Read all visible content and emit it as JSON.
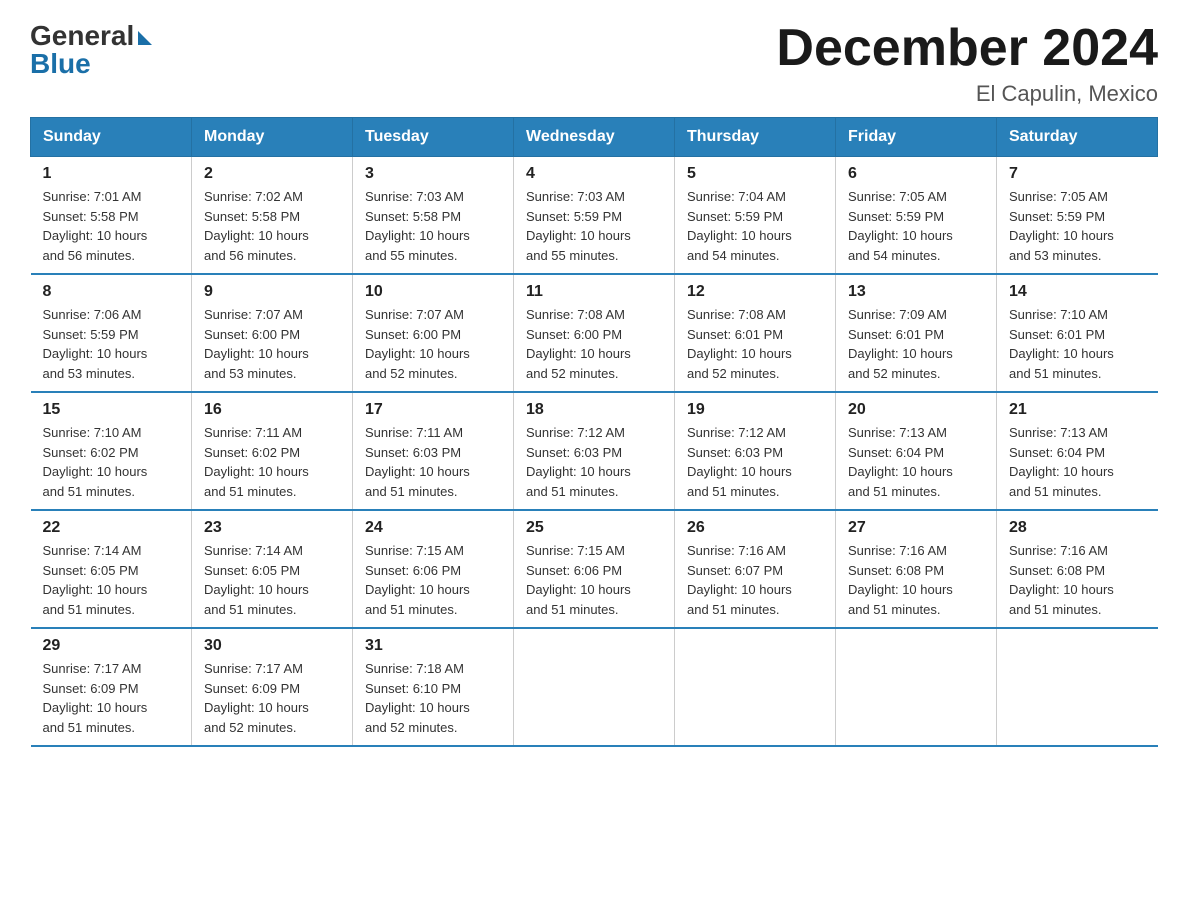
{
  "logo": {
    "general": "General",
    "blue": "Blue"
  },
  "title": {
    "month_year": "December 2024",
    "location": "El Capulin, Mexico"
  },
  "days_of_week": [
    "Sunday",
    "Monday",
    "Tuesday",
    "Wednesday",
    "Thursday",
    "Friday",
    "Saturday"
  ],
  "weeks": [
    [
      {
        "day": "1",
        "sunrise": "7:01 AM",
        "sunset": "5:58 PM",
        "daylight": "10 hours and 56 minutes."
      },
      {
        "day": "2",
        "sunrise": "7:02 AM",
        "sunset": "5:58 PM",
        "daylight": "10 hours and 56 minutes."
      },
      {
        "day": "3",
        "sunrise": "7:03 AM",
        "sunset": "5:58 PM",
        "daylight": "10 hours and 55 minutes."
      },
      {
        "day": "4",
        "sunrise": "7:03 AM",
        "sunset": "5:59 PM",
        "daylight": "10 hours and 55 minutes."
      },
      {
        "day": "5",
        "sunrise": "7:04 AM",
        "sunset": "5:59 PM",
        "daylight": "10 hours and 54 minutes."
      },
      {
        "day": "6",
        "sunrise": "7:05 AM",
        "sunset": "5:59 PM",
        "daylight": "10 hours and 54 minutes."
      },
      {
        "day": "7",
        "sunrise": "7:05 AM",
        "sunset": "5:59 PM",
        "daylight": "10 hours and 53 minutes."
      }
    ],
    [
      {
        "day": "8",
        "sunrise": "7:06 AM",
        "sunset": "5:59 PM",
        "daylight": "10 hours and 53 minutes."
      },
      {
        "day": "9",
        "sunrise": "7:07 AM",
        "sunset": "6:00 PM",
        "daylight": "10 hours and 53 minutes."
      },
      {
        "day": "10",
        "sunrise": "7:07 AM",
        "sunset": "6:00 PM",
        "daylight": "10 hours and 52 minutes."
      },
      {
        "day": "11",
        "sunrise": "7:08 AM",
        "sunset": "6:00 PM",
        "daylight": "10 hours and 52 minutes."
      },
      {
        "day": "12",
        "sunrise": "7:08 AM",
        "sunset": "6:01 PM",
        "daylight": "10 hours and 52 minutes."
      },
      {
        "day": "13",
        "sunrise": "7:09 AM",
        "sunset": "6:01 PM",
        "daylight": "10 hours and 52 minutes."
      },
      {
        "day": "14",
        "sunrise": "7:10 AM",
        "sunset": "6:01 PM",
        "daylight": "10 hours and 51 minutes."
      }
    ],
    [
      {
        "day": "15",
        "sunrise": "7:10 AM",
        "sunset": "6:02 PM",
        "daylight": "10 hours and 51 minutes."
      },
      {
        "day": "16",
        "sunrise": "7:11 AM",
        "sunset": "6:02 PM",
        "daylight": "10 hours and 51 minutes."
      },
      {
        "day": "17",
        "sunrise": "7:11 AM",
        "sunset": "6:03 PM",
        "daylight": "10 hours and 51 minutes."
      },
      {
        "day": "18",
        "sunrise": "7:12 AM",
        "sunset": "6:03 PM",
        "daylight": "10 hours and 51 minutes."
      },
      {
        "day": "19",
        "sunrise": "7:12 AM",
        "sunset": "6:03 PM",
        "daylight": "10 hours and 51 minutes."
      },
      {
        "day": "20",
        "sunrise": "7:13 AM",
        "sunset": "6:04 PM",
        "daylight": "10 hours and 51 minutes."
      },
      {
        "day": "21",
        "sunrise": "7:13 AM",
        "sunset": "6:04 PM",
        "daylight": "10 hours and 51 minutes."
      }
    ],
    [
      {
        "day": "22",
        "sunrise": "7:14 AM",
        "sunset": "6:05 PM",
        "daylight": "10 hours and 51 minutes."
      },
      {
        "day": "23",
        "sunrise": "7:14 AM",
        "sunset": "6:05 PM",
        "daylight": "10 hours and 51 minutes."
      },
      {
        "day": "24",
        "sunrise": "7:15 AM",
        "sunset": "6:06 PM",
        "daylight": "10 hours and 51 minutes."
      },
      {
        "day": "25",
        "sunrise": "7:15 AM",
        "sunset": "6:06 PM",
        "daylight": "10 hours and 51 minutes."
      },
      {
        "day": "26",
        "sunrise": "7:16 AM",
        "sunset": "6:07 PM",
        "daylight": "10 hours and 51 minutes."
      },
      {
        "day": "27",
        "sunrise": "7:16 AM",
        "sunset": "6:08 PM",
        "daylight": "10 hours and 51 minutes."
      },
      {
        "day": "28",
        "sunrise": "7:16 AM",
        "sunset": "6:08 PM",
        "daylight": "10 hours and 51 minutes."
      }
    ],
    [
      {
        "day": "29",
        "sunrise": "7:17 AM",
        "sunset": "6:09 PM",
        "daylight": "10 hours and 51 minutes."
      },
      {
        "day": "30",
        "sunrise": "7:17 AM",
        "sunset": "6:09 PM",
        "daylight": "10 hours and 52 minutes."
      },
      {
        "day": "31",
        "sunrise": "7:18 AM",
        "sunset": "6:10 PM",
        "daylight": "10 hours and 52 minutes."
      },
      null,
      null,
      null,
      null
    ]
  ],
  "labels": {
    "sunrise": "Sunrise:",
    "sunset": "Sunset:",
    "daylight": "Daylight:"
  }
}
